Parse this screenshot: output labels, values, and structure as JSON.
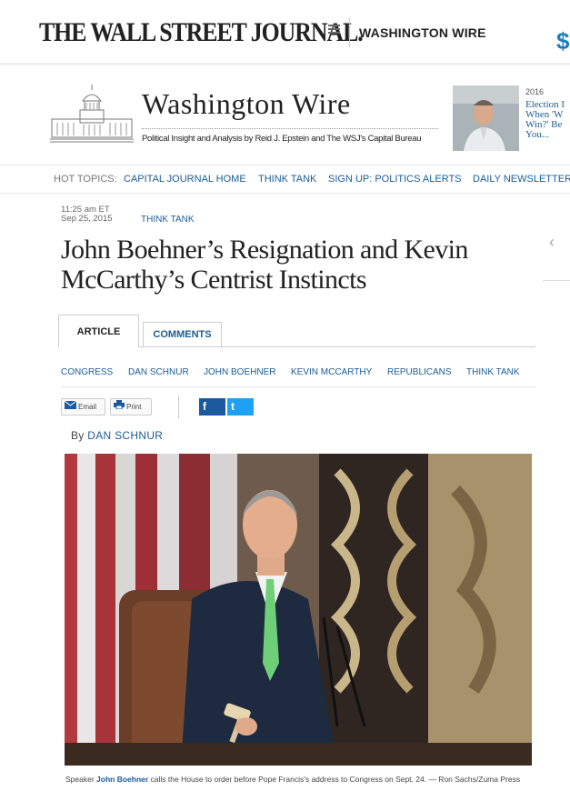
{
  "masthead": {
    "logo": "THE WALL STREET JOURNAL.",
    "section": "WASHINGTON WIRE",
    "dollar": "$"
  },
  "blog": {
    "title": "Washington Wire",
    "tagline": "Political Insight and Analysis by Reid J. Epstein and The WSJ's Capital Bureau",
    "promo_year": "2016",
    "promo_text": "Election I\nWhen 'W\nWin?' Be\nYou..."
  },
  "hot_topics": {
    "label": "HOT TOPICS:",
    "items": [
      "CAPITAL JOURNAL HOME",
      "THINK TANK",
      "SIGN UP: POLITICS ALERTS",
      "DAILY NEWSLETTER"
    ]
  },
  "article": {
    "time": "11:25 am ET",
    "date": "Sep 25, 2015",
    "kicker": "THINK TANK",
    "headline": "John Boehner’s Resignation and Kevin McCarthy’s Centrist Instincts",
    "tabs": [
      "ARTICLE",
      "COMMENTS"
    ],
    "tags": [
      "CONGRESS",
      "DAN SCHNUR",
      "JOHN BOEHNER",
      "KEVIN MCCARTHY",
      "REPUBLICANS",
      "THINK TANK"
    ],
    "share": {
      "email": "Email",
      "print": "Print",
      "fb": "f",
      "tw": "t"
    },
    "byline_prefix": "By",
    "author": "DAN SCHNUR",
    "caption_pre": "Speaker ",
    "caption_link": "John Boehner",
    "caption_post": " calls the House to order before Pope Francis's address to Congress on Sept. 24. — Ron Sachs/Zuma Press"
  },
  "colors": {
    "link": "#1a5c96",
    "dollar": "#1a7dc2",
    "facebook": "#1b5a9e",
    "twitter": "#1da1f2"
  }
}
